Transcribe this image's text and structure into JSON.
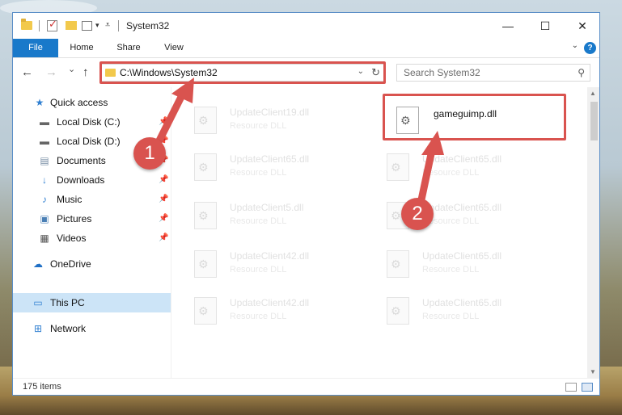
{
  "window": {
    "title": "System32",
    "controls": {
      "minimize": "—",
      "maximize": "☐",
      "close": "✕"
    }
  },
  "ribbon": {
    "tabs": [
      "File",
      "Home",
      "Share",
      "View"
    ],
    "help": "?"
  },
  "navigation": {
    "back": "←",
    "forward": "→",
    "recent": "⌄",
    "up": "↑",
    "address": "C:\\Windows\\System32",
    "search_placeholder": "Search System32"
  },
  "sidebar": {
    "items": [
      {
        "label": "Quick access",
        "icon": "star-icon",
        "pinned": false
      },
      {
        "label": "Local Disk (C:)",
        "icon": "drive-icon",
        "pinned": true
      },
      {
        "label": "Local Disk (D:)",
        "icon": "drive-icon",
        "pinned": true
      },
      {
        "label": "Documents",
        "icon": "documents-icon",
        "pinned": true
      },
      {
        "label": "Downloads",
        "icon": "download-icon",
        "pinned": true
      },
      {
        "label": "Music",
        "icon": "music-icon",
        "pinned": true
      },
      {
        "label": "Pictures",
        "icon": "pictures-icon",
        "pinned": true
      },
      {
        "label": "Videos",
        "icon": "videos-icon",
        "pinned": true
      },
      {
        "label": "OneDrive",
        "icon": "cloud-icon",
        "pinned": false
      },
      {
        "label": "This PC",
        "icon": "computer-icon",
        "pinned": false,
        "selected": true
      },
      {
        "label": "Network",
        "icon": "network-icon",
        "pinned": false
      }
    ]
  },
  "files": {
    "left_column": [
      {
        "name": "UpdateClient19.dll",
        "type": "Resource DLL"
      },
      {
        "name": "UpdateClient65.dll",
        "type": "Resource DLL"
      },
      {
        "name": "UpdateClient5.dll",
        "type": "Resource DLL"
      },
      {
        "name": "UpdateClient42.dll",
        "type": "Resource DLL"
      },
      {
        "name": "UpdateClient42.dll",
        "type": "Resource DLL"
      }
    ],
    "right_column": [
      {
        "name": "gameguimp.dll",
        "type": ""
      },
      {
        "name": "UpdateClient65.dll",
        "type": "Resource DLL"
      },
      {
        "name": "UpdateClient65.dll",
        "type": "Resource DLL"
      },
      {
        "name": "UpdateClient65.dll",
        "type": "Resource DLL"
      },
      {
        "name": "UpdateClient65.dll",
        "type": "Resource DLL"
      }
    ]
  },
  "status": {
    "items_count": "175 items"
  },
  "callouts": [
    "1",
    "2"
  ],
  "colors": {
    "accent": "#1979ca",
    "highlight": "#d9534f",
    "selected": "#cce4f7"
  }
}
